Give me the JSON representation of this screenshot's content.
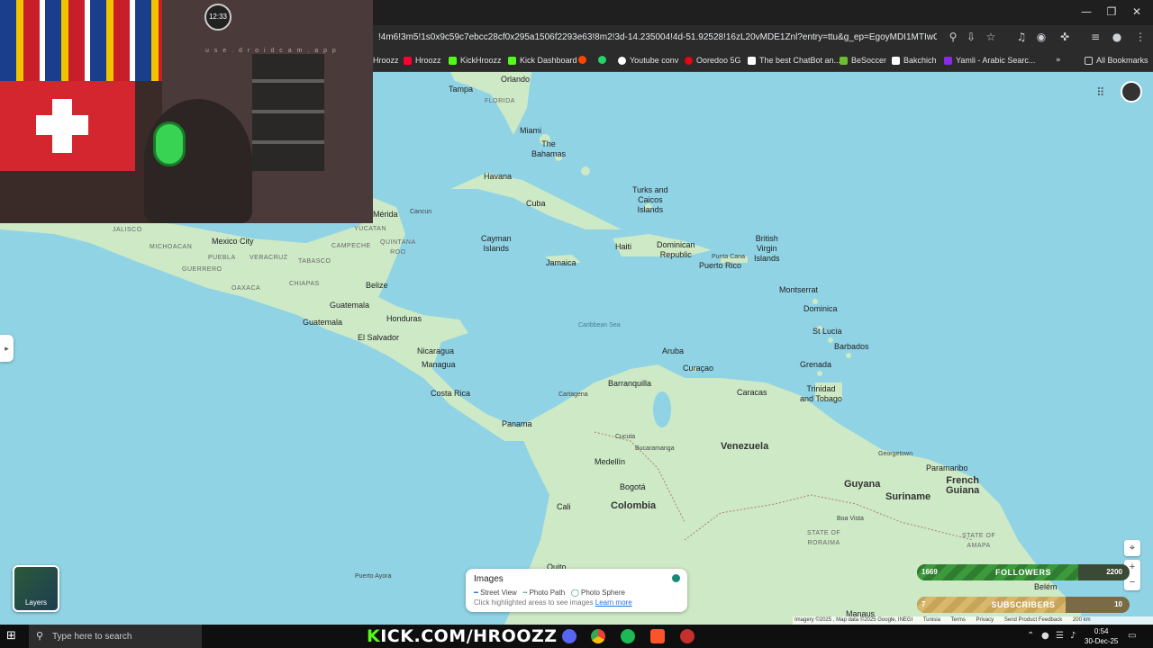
{
  "browser": {
    "url": "!4m6!3m5!1s0x9c59c7ebcc28cf0x295a1506f2293e63!8m2!3d-14.235004!4d-51.92528!16zL20vMDE1Znl?entry=ttu&g_ep=EgoyMDI1MTIwOS4wIKXM...",
    "bookmarks": [
      {
        "label": "Hroozz",
        "color": "#888"
      },
      {
        "label": "Hroozz",
        "color": "#ff0033"
      },
      {
        "label": "KickHroozz",
        "color": "#53fc18"
      },
      {
        "label": "Kick Dashboard",
        "color": "#53fc18"
      },
      {
        "label": "",
        "color": "#ff4500"
      },
      {
        "label": "",
        "color": "#25d366"
      },
      {
        "label": "Youtube conv",
        "color": "#ffffff"
      },
      {
        "label": "Ooredoo 5G",
        "color": "#e30613"
      },
      {
        "label": "The best ChatBot an...",
        "color": "#ffffff"
      },
      {
        "label": "BeSoccer",
        "color": "#6abf2e"
      },
      {
        "label": "Bakchich",
        "color": "#ffffff"
      },
      {
        "label": "Yamli - Arabic Searc...",
        "color": "#8a2be2"
      }
    ],
    "all_bookmarks": "All Bookmarks"
  },
  "map": {
    "labels": {
      "tampa": "Tampa",
      "orlando": "Orlando",
      "florida": "FLORIDA",
      "miami": "Miami",
      "bahamas": "The\nBahamas",
      "havana": "Havana",
      "cuba": "Cuba",
      "turks": "Turks and\nCaicos\nIslands",
      "cayman": "Cayman\nIslands",
      "jamaica": "Jamaica",
      "haiti": "Haiti",
      "dominican": "Dominican\nRepublic",
      "puntacana": "Punta Cana",
      "puertorico": "Puerto Rico",
      "bvi": "British\nVirgin\nIslands",
      "montserrat": "Montserrat",
      "dominica": "Dominica",
      "stlucia": "St Lucia",
      "barbados": "Barbados",
      "grenada": "Grenada",
      "trinidad": "Trinidad\nand Tobago",
      "caribbean": "Caribbean Sea",
      "merida": "Mérida",
      "cancun": "Cancun",
      "yucatan": "YUCATAN",
      "quintana": "QUINTANA\nROO",
      "campeche": "CAMPECHE",
      "jalisco": "JALISCO",
      "michoacan": "MICHOACAN",
      "mexicocity": "Mexico City",
      "puebla": "PUEBLA",
      "veracruz": "VERACRUZ",
      "tabasco": "TABASCO",
      "guerrero": "GUERRERO",
      "oaxaca": "OAXACA",
      "chiapas": "CHIAPAS",
      "belize": "Belize",
      "guatemala": "Guatemala",
      "guatemalacity": "Guatemala",
      "honduras": "Honduras",
      "elsalvador": "El Salvador",
      "nicaragua": "Nicaragua",
      "managua": "Managua",
      "costarica": "Costa Rica",
      "panama": "Panama",
      "aruba": "Aruba",
      "curacao": "Curaçao",
      "barranquilla": "Barranquilla",
      "cartagena": "Cartagena",
      "caracas": "Caracas",
      "venezuela": "Venezuela",
      "cucuta": "Cucuta",
      "bucaramanga": "Bucaramanga",
      "medellin": "Medellín",
      "bogota": "Bogotá",
      "colombia": "Colombia",
      "cali": "Cali",
      "quito": "Quito",
      "georgetown": "Georgetown",
      "paramaribo": "Paramaribo",
      "guyana": "Guyana",
      "suriname": "Suriname",
      "frenchguiana": "French\nGuiana",
      "boavista": "Boa Vista",
      "roraima": "STATE OF\nRORAIMA",
      "amapa": "STATE OF\nAMAPA",
      "belem": "Belém",
      "manaus": "Manaus",
      "puertoayora": "Puerto Ayora"
    },
    "layers_label": "Layers",
    "images": {
      "title": "Images",
      "legend": [
        "Street View",
        "Photo Path",
        "Photo Sphere"
      ],
      "hint": "Click highlighted areas to see images",
      "learn_more": "Learn more"
    },
    "attribution": [
      "Imagery ©2025 , Map data ©2025 Google, INEGI",
      "Tunisia",
      "Terms",
      "Privacy",
      "Send Product Feedback",
      "200 km"
    ]
  },
  "webcam": {
    "clock": "12:33",
    "watermark": "u s e . d r o i d c a m . a p p"
  },
  "overlay": {
    "followers": {
      "current": "1669",
      "label": "FOLLOWERS",
      "goal": "2200",
      "progress": 0.76
    },
    "subscribers": {
      "current": "7",
      "label": "SUBSCRIBERS",
      "goal": "10",
      "progress": 0.7
    }
  },
  "taskbar": {
    "search_placeholder": "Type here to search",
    "kick_prefix": "K",
    "kick_url": "ICK.COM/HROOZZ",
    "time": "0:54",
    "date": "30-Dec-25"
  },
  "colors": {
    "sea": "#8fd3e5",
    "land": "#cde9c6",
    "kick_green": "#53fc18"
  }
}
